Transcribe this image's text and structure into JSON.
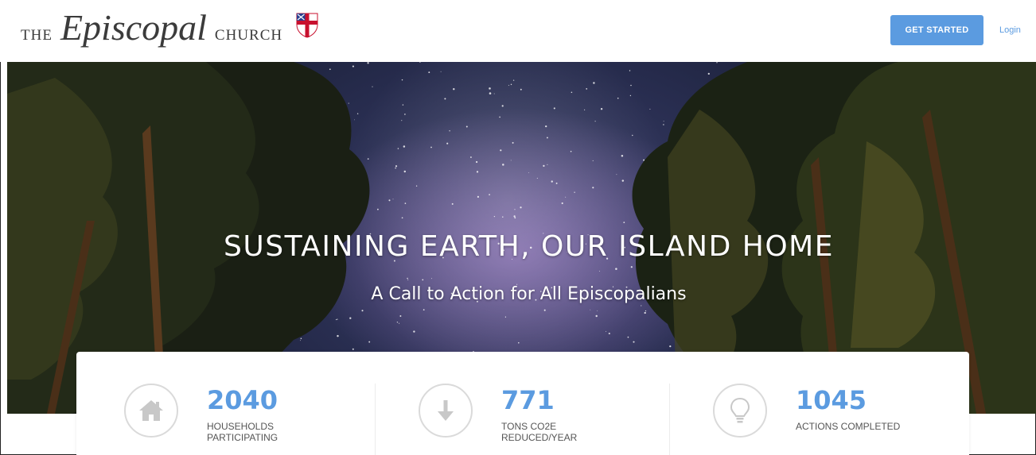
{
  "header": {
    "logo_the": "THE",
    "logo_brand": "Episcopal",
    "logo_church": "CHURCH",
    "get_started": "GET STARTED",
    "login": "Login"
  },
  "hero": {
    "title": "SUSTAINING EARTH, OUR ISLAND HOME",
    "subtitle": "A Call to Action for All Episcopalians"
  },
  "stats": [
    {
      "value": "2040",
      "label_line1": "HOUSEHOLDS",
      "label_line2": "PARTICIPATING",
      "icon": "house-icon"
    },
    {
      "value": "771",
      "label_line1": "TONS CO2E",
      "label_line2": "REDUCED/YEAR",
      "icon": "down-arrow-icon"
    },
    {
      "value": "1045",
      "label_line1": "ACTIONS COMPLETED",
      "label_line2": "",
      "icon": "lightbulb-icon"
    }
  ],
  "colors": {
    "accent": "#5b9be0",
    "icon_gray": "#c8c8c8"
  }
}
